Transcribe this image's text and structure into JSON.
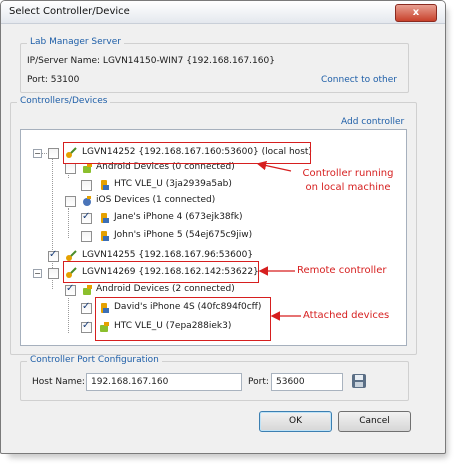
{
  "window": {
    "title": "Select Controller/Device",
    "close_label": "x"
  },
  "server_group": {
    "legend": "Lab Manager Server",
    "ip_line": "IP/Server Name: LGVN14150-WIN7 {192.168.167.160}",
    "port_line": "Port: 53100",
    "connect_link": "Connect to other"
  },
  "controllers_group": {
    "legend": "Controllers/Devices",
    "add_link": "Add controller",
    "tree": [
      {
        "label": "LGVN14252 {192.168.167.160:53600} (local host)",
        "checked": false
      },
      {
        "label": "Android Devices (0 connected)",
        "checked": false
      },
      {
        "label": "HTC VLE_U (3ja2939a5ab)",
        "checked": false
      },
      {
        "label": "iOS Devices (1 connected)",
        "checked": false
      },
      {
        "label": "Jane's iPhone 4 (673ejk38fk)",
        "checked": true
      },
      {
        "label": "John's iPhone 5 (54ej675c9jiw)",
        "checked": false
      },
      {
        "label": "LGVN14255 {192.168.167.96:53600}",
        "checked": true
      },
      {
        "label": "LGVN14269 {192.168.162.142:53622}",
        "checked": false
      },
      {
        "label": "Android Devices (2 connected)",
        "checked": true
      },
      {
        "label": "David's iPhone 4S (40fc894f0cff)",
        "checked": true
      },
      {
        "label": "HTC VLE_U (7epa288iek3)",
        "checked": true
      }
    ],
    "annotations": {
      "controller_running": "Controller running\non local machine",
      "remote_controller": "Remote controller",
      "attached_devices": "Attached devices"
    }
  },
  "port_group": {
    "legend": "Controller Port Configuration",
    "host_label": "Host Name:",
    "host_value": "192.168.167.160",
    "port_label": "Port:",
    "port_value": "53600"
  },
  "buttons": {
    "ok": "OK",
    "cancel": "Cancel"
  },
  "colors": {
    "accent": "#1f5fa8",
    "annotation": "#d61f1f"
  },
  "icons": [
    "controller-icon",
    "android-icon",
    "apple-icon",
    "device-icon",
    "save-icon"
  ]
}
